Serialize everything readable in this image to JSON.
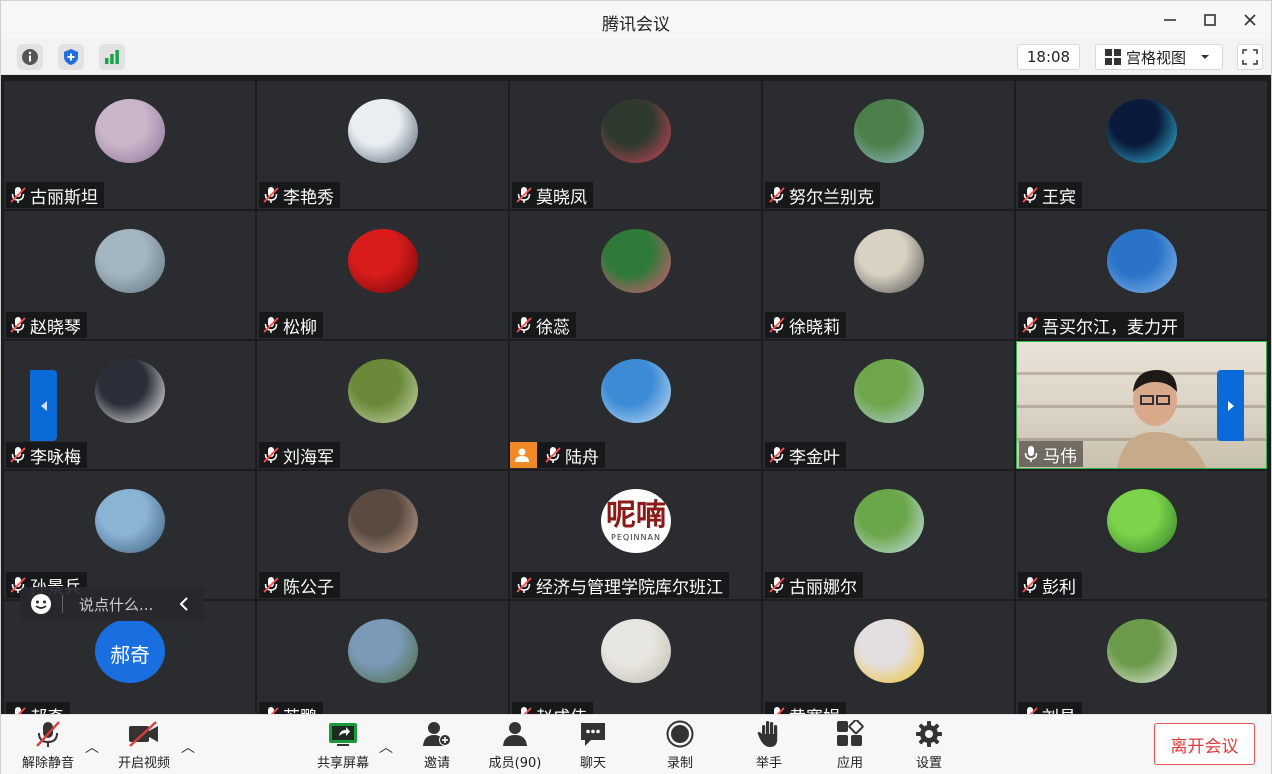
{
  "window": {
    "title": "腾讯会议"
  },
  "toolbar": {
    "time": "18:08",
    "view_label": "宫格视图"
  },
  "participants": [
    {
      "name": "古丽斯坦",
      "avatar": [
        "#c9b6c8",
        "#8a6f99"
      ]
    },
    {
      "name": "李艳秀",
      "avatar": [
        "#e9eef3",
        "#4a5a6a"
      ]
    },
    {
      "name": "莫晓凤",
      "avatar": [
        "#2e3a2e",
        "#d7465b"
      ]
    },
    {
      "name": "努尔兰别克",
      "avatar": [
        "#4c7f4a",
        "#9ac3d9"
      ]
    },
    {
      "name": "王宾",
      "avatar": [
        "#0a1a3a",
        "#38c3e8"
      ]
    },
    {
      "name": "赵晓琴",
      "avatar": [
        "#a4b5c2",
        "#5f707d"
      ]
    },
    {
      "name": "松柳",
      "avatar": [
        "#d81c1c",
        "#6b0505"
      ]
    },
    {
      "name": "徐蕊",
      "avatar": [
        "#2f7a3a",
        "#e6557a"
      ]
    },
    {
      "name": "徐晓莉",
      "avatar": [
        "#d9d2c3",
        "#4a4a4a"
      ]
    },
    {
      "name": "吾买尔江，麦力开",
      "avatar": [
        "#2a73c9",
        "#8fbde8"
      ]
    },
    {
      "name": "李咏梅",
      "avatar": [
        "#2a2f3a",
        "#ffffff"
      ]
    },
    {
      "name": "刘海军",
      "avatar": [
        "#6a8a3a",
        "#cfd8b0"
      ]
    },
    {
      "name": "陆舟",
      "avatar": [
        "#3d8bd6",
        "#c9e3f5"
      ]
    },
    {
      "name": "李金叶",
      "avatar": [
        "#6fa64c",
        "#b9d4e8"
      ]
    },
    {
      "name": "马伟",
      "avatar": [
        "#d8d0c2",
        "#5a4a3a"
      ]
    },
    {
      "name": "孙景兵",
      "avatar": [
        "#8ab3d4",
        "#3a5a7a"
      ]
    },
    {
      "name": "陈公子",
      "avatar": [
        "#5a4a40",
        "#c9a995"
      ]
    },
    {
      "name": "经济与管理学院库尔班江",
      "avatar": [
        "#ffffff",
        "#8b1a1a"
      ]
    },
    {
      "name": "古丽娜尔",
      "avatar": [
        "#6aa64a",
        "#d0e2f0"
      ]
    },
    {
      "name": "彭利",
      "avatar": [
        "#7dd44a",
        "#2e7a2a"
      ]
    },
    {
      "name": "郝奇",
      "avatar": [
        "#1a6fe0",
        "#1a6fe0"
      ]
    },
    {
      "name": "苏鹏",
      "avatar": [
        "#7a9ab8",
        "#4a6a3a"
      ]
    },
    {
      "name": "赵成伟",
      "avatar": [
        "#e8e6e0",
        "#bdb9b0"
      ]
    },
    {
      "name": "黄寨娟",
      "avatar": [
        "#e3dfe0",
        "#f0c020"
      ]
    },
    {
      "name": "刘昌",
      "avatar": [
        "#6a9a4a",
        "#f3f3f3"
      ]
    }
  ],
  "special": {
    "peqinnan_logo_text": "呢喃",
    "peqinnan_sub": "PEQINNAN",
    "haoqi_avatar_text": "郝奇"
  },
  "chat": {
    "placeholder": "说点什么..."
  },
  "bottom_bar": {
    "unmute": "解除静音",
    "start_video": "开启视频",
    "share_screen": "共享屏幕",
    "invite": "邀请",
    "members": "成员(90)",
    "chat": "聊天",
    "record": "录制",
    "raise_hand": "举手",
    "apps": "应用",
    "settings": "设置",
    "leave": "离开会议"
  },
  "colors": {
    "accent_blue": "#0a6bd8",
    "leave_red": "#e03b3b",
    "share_green": "#1a9a3a"
  }
}
